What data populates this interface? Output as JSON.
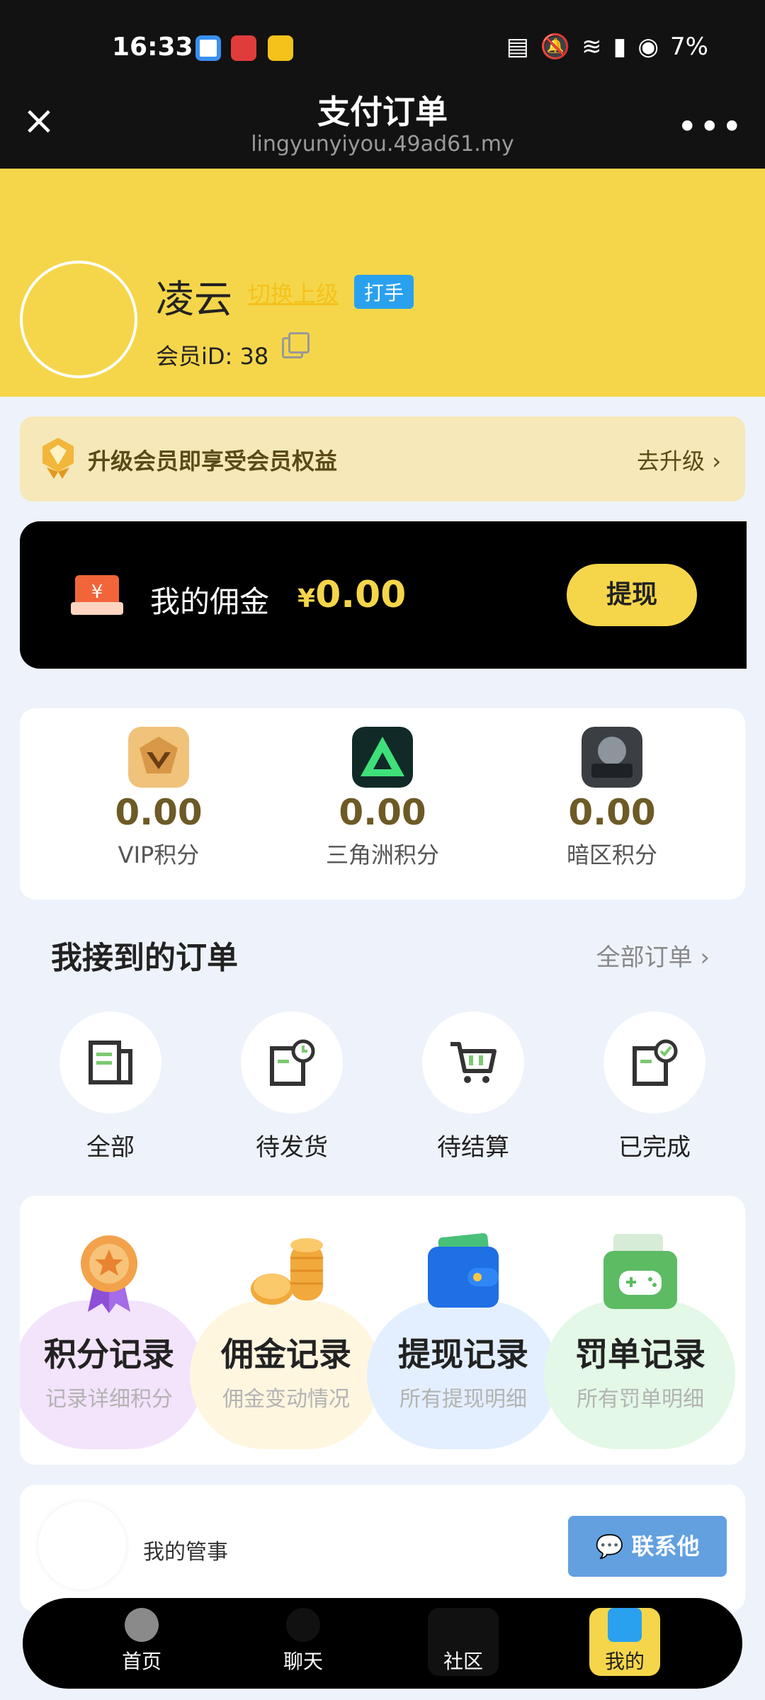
{
  "status_bar": {
    "time": "16:33",
    "battery": "7%"
  },
  "nav": {
    "title": "支付订单",
    "url": "lingyunyiyou.49ad61.my"
  },
  "profile": {
    "name": "凌云",
    "switch_link": "切换上级",
    "role_badge": "打手",
    "member_id": "会员iD: 38"
  },
  "upgrade_banner": {
    "text": "升级会员即享受会员权益",
    "link": "去升级"
  },
  "commission": {
    "label": "我的佣金",
    "currency": "¥",
    "amount": "0.00",
    "button": "提现"
  },
  "points": [
    {
      "value": "0.00",
      "label": "VIP积分"
    },
    {
      "value": "0.00",
      "label": "三角洲积分"
    },
    {
      "value": "0.00",
      "label": "暗区积分"
    }
  ],
  "orders": {
    "title": "我接到的订单",
    "all_link": "全部订单",
    "items": [
      {
        "label": "全部"
      },
      {
        "label": "待发货"
      },
      {
        "label": "待结算"
      },
      {
        "label": "已完成"
      }
    ]
  },
  "records": [
    {
      "title": "积分记录",
      "subtitle": "记录详细积分",
      "color": "#f3e3fb"
    },
    {
      "title": "佣金记录",
      "subtitle": "佣金变动情况",
      "color": "#fff6e0"
    },
    {
      "title": "提现记录",
      "subtitle": "所有提现明细",
      "color": "#e3efff"
    },
    {
      "title": "罚单记录",
      "subtitle": "所有罚单明细",
      "color": "#e3f8e6"
    }
  ],
  "manager": {
    "label": "我的管事",
    "contact_button": "联系他"
  },
  "tabbar": [
    {
      "label": "首页"
    },
    {
      "label": "聊天"
    },
    {
      "label": "社区"
    },
    {
      "label": "我的"
    }
  ],
  "colors": {
    "brand_yellow": "#f5d64a",
    "dark": "#000000",
    "points_gold": "#6d5a26",
    "contact_blue": "#62a0e0"
  }
}
